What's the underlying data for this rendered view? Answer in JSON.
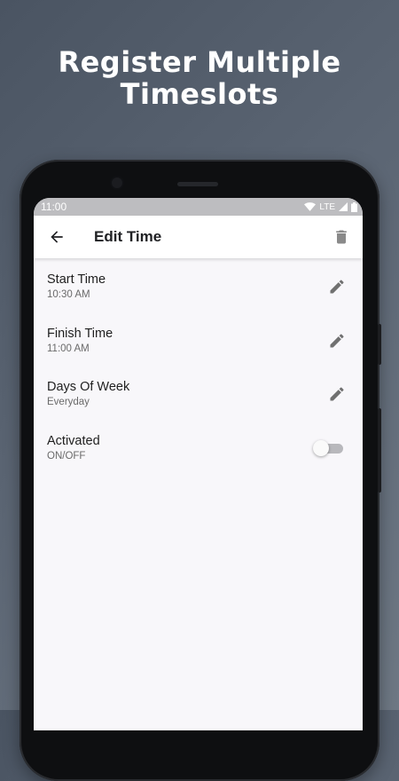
{
  "headline": {
    "line1": "Register Multiple",
    "line2": "Timeslots"
  },
  "statusbar": {
    "time": "11:00",
    "network": "LTE"
  },
  "appbar": {
    "title": "Edit Time"
  },
  "items": [
    {
      "title": "Start Time",
      "subtitle": "10:30 AM",
      "action": "edit-icon"
    },
    {
      "title": "Finish Time",
      "subtitle": "11:00 AM",
      "action": "edit-icon"
    },
    {
      "title": "Days Of Week",
      "subtitle": "Everyday",
      "action": "edit-icon"
    },
    {
      "title": "Activated",
      "subtitle": "ON/OFF",
      "action": "toggle",
      "toggle_on": false
    }
  ],
  "colors": {
    "background": "#5b6573",
    "screen": "#f8f7fa",
    "icon": "#707070",
    "statusbar": "#bdbdc0"
  }
}
